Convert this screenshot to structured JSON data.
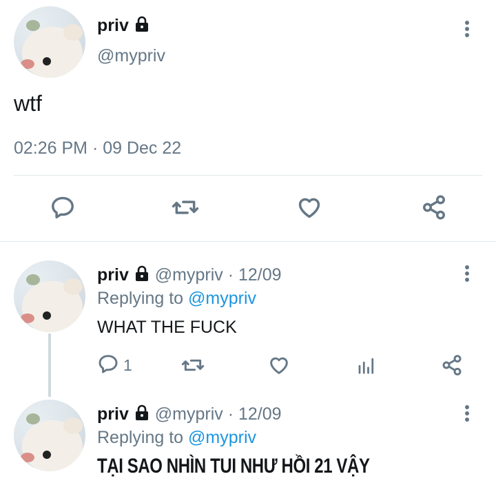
{
  "main_tweet": {
    "display_name": "priv",
    "handle": "@mypriv",
    "text": "wtf",
    "timestamp": "02:26 PM · 09 Dec 22"
  },
  "replies": [
    {
      "display_name": "priv",
      "handle": "@mypriv",
      "date": "· 12/09",
      "replying_prefix": "Replying to",
      "replying_to": "@mypriv",
      "text": "WHAT THE FUCK",
      "reply_count": "1"
    },
    {
      "display_name": "priv",
      "handle": "@mypriv",
      "date": "· 12/09",
      "replying_prefix": "Replying to",
      "replying_to": "@mypriv",
      "text": "TẠI SAO NHÌN TUI NHƯ HỒI 21 VẬY"
    }
  ],
  "colors": {
    "text": "#14171a",
    "secondary": "#657786",
    "link": "#1b95e0",
    "divider": "#e1e8ed"
  },
  "icons": [
    "lock-icon",
    "more-options-icon",
    "reply-icon",
    "retweet-icon",
    "like-icon",
    "share-icon",
    "analytics-icon"
  ]
}
